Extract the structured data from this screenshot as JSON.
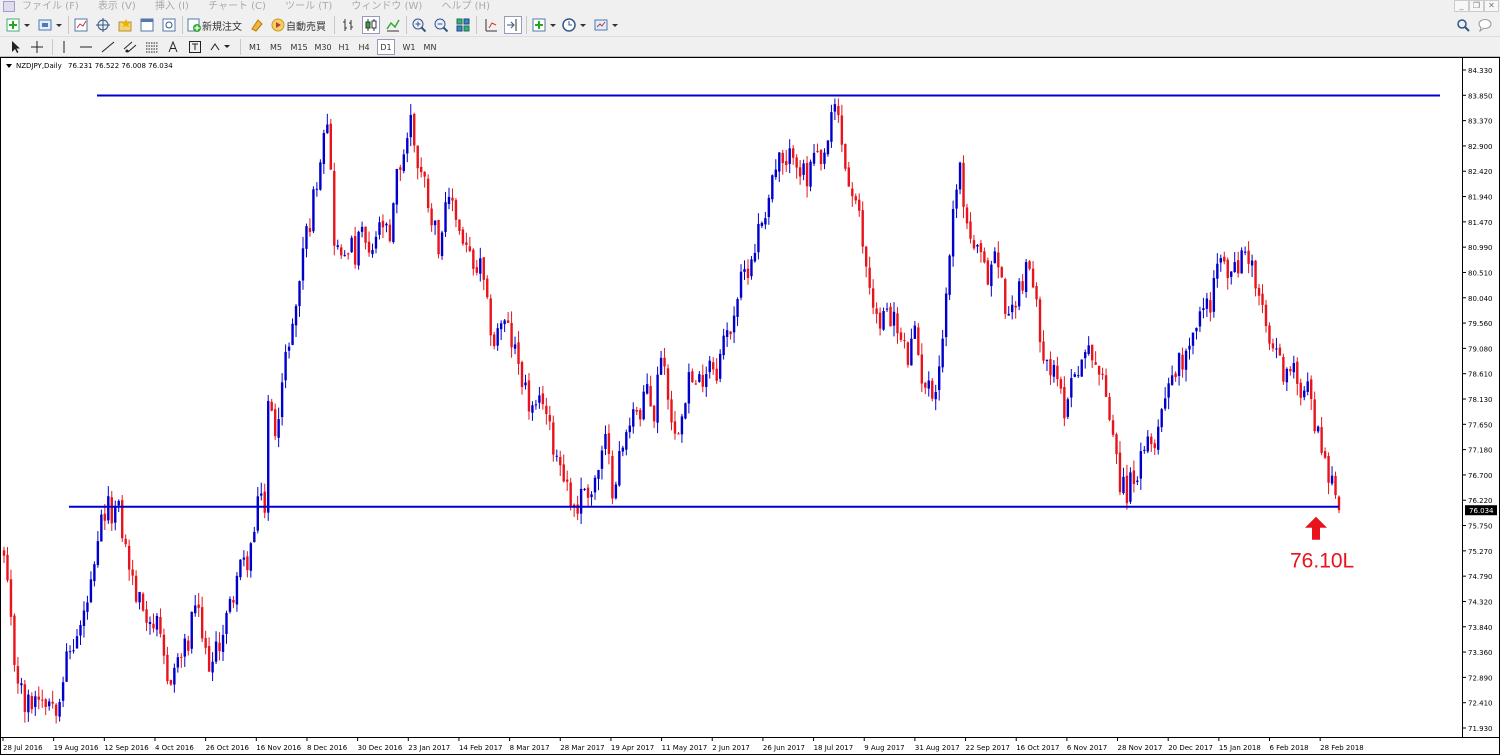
{
  "menu": [
    "ファイル (F)",
    "表示 (V)",
    "挿入 (I)",
    "チャート (C)",
    "ツール (T)",
    "ウィンドウ (W)",
    "ヘルプ (H)"
  ],
  "toolbar": {
    "new_order": "新規注文",
    "auto_trading": "自動売買"
  },
  "timeframes": [
    "M1",
    "M5",
    "M15",
    "M30",
    "H1",
    "H4",
    "D1",
    "W1",
    "MN"
  ],
  "active_timeframe": "D1",
  "chart_header": {
    "symbol": "NZDJPY,Daily",
    "ohlc": "76.231 76.522 76.008 76.034"
  },
  "annotation": {
    "label": "76.10L",
    "color": "#e8131b"
  },
  "colors": {
    "bull": "#0000cc",
    "bear": "#e8131b",
    "line": "#0000cc"
  },
  "chart_data": {
    "type": "candlestick",
    "y_ticks": [
      "84.330",
      "83.850",
      "83.370",
      "82.900",
      "82.420",
      "81.940",
      "81.470",
      "80.990",
      "80.510",
      "80.040",
      "79.560",
      "79.080",
      "78.610",
      "78.130",
      "77.650",
      "77.180",
      "76.700",
      "76.220",
      "75.750",
      "75.270",
      "74.790",
      "74.320",
      "73.840",
      "73.360",
      "72.890",
      "72.410",
      "71.930"
    ],
    "x_ticks": [
      "28 Jul 2016",
      "19 Aug 2016",
      "12 Sep 2016",
      "4 Oct 2016",
      "26 Oct 2016",
      "16 Nov 2016",
      "8 Dec 2016",
      "30 Dec 2016",
      "23 Jan 2017",
      "14 Feb 2017",
      "8 Mar 2017",
      "28 Mar 2017",
      "19 Apr 2017",
      "11 May 2017",
      "2 Jun 2017",
      "26 Jun 2017",
      "18 Jul 2017",
      "9 Aug 2017",
      "31 Aug 2017",
      "22 Sep 2017",
      "16 Oct 2017",
      "6 Nov 2017",
      "28 Nov 2017",
      "20 Dec 2017",
      "15 Jan 2018",
      "6 Feb 2018",
      "28 Feb 2018"
    ],
    "ylim": [
      71.93,
      84.33
    ],
    "current_price": "76.034",
    "resistance_level": 83.85,
    "support_level": 76.1,
    "path": [
      [
        0,
        75.1
      ],
      [
        3,
        73.2
      ],
      [
        6,
        72.3
      ],
      [
        10,
        72.6
      ],
      [
        15,
        72.4
      ],
      [
        18,
        73.2
      ],
      [
        22,
        73.8
      ],
      [
        26,
        74.8
      ],
      [
        28,
        75.8
      ],
      [
        30,
        76.05
      ],
      [
        33,
        76.0
      ],
      [
        35,
        75.3
      ],
      [
        38,
        74.4
      ],
      [
        41,
        74.1
      ],
      [
        44,
        73.8
      ],
      [
        47,
        72.8
      ],
      [
        50,
        73.2
      ],
      [
        53,
        73.5
      ],
      [
        55,
        74.3
      ],
      [
        58,
        73.3
      ],
      [
        60,
        73.1
      ],
      [
        63,
        73.8
      ],
      [
        65,
        74.2
      ],
      [
        67,
        74.8
      ],
      [
        70,
        75.1
      ],
      [
        72,
        75.6
      ],
      [
        74,
        76.5
      ],
      [
        75,
        76.0
      ],
      [
        76,
        78.0
      ],
      [
        78,
        77.6
      ],
      [
        80,
        78.4
      ],
      [
        82,
        79.3
      ],
      [
        84,
        79.8
      ],
      [
        86,
        81.0
      ],
      [
        88,
        81.5
      ],
      [
        90,
        82.3
      ],
      [
        92,
        83.3
      ],
      [
        93,
        83.5
      ],
      [
        95,
        81.2
      ],
      [
        97,
        80.7
      ],
      [
        99,
        81.1
      ],
      [
        101,
        80.8
      ],
      [
        103,
        81.3
      ],
      [
        105,
        80.7
      ],
      [
        107,
        81.2
      ],
      [
        109,
        81.4
      ],
      [
        111,
        81.0
      ],
      [
        113,
        82.3
      ],
      [
        115,
        82.8
      ],
      [
        117,
        83.4
      ],
      [
        119,
        82.6
      ],
      [
        121,
        82.2
      ],
      [
        123,
        81.6
      ],
      [
        125,
        81.1
      ],
      [
        127,
        81.6
      ],
      [
        129,
        81.9
      ],
      [
        131,
        81.3
      ],
      [
        133,
        81.0
      ],
      [
        135,
        80.5
      ],
      [
        137,
        80.6
      ],
      [
        139,
        79.8
      ],
      [
        141,
        79.2
      ],
      [
        143,
        79.6
      ],
      [
        145,
        79.4
      ],
      [
        147,
        79.0
      ],
      [
        149,
        78.6
      ],
      [
        151,
        78.0
      ],
      [
        153,
        77.8
      ],
      [
        155,
        78.2
      ],
      [
        157,
        77.5
      ],
      [
        159,
        77.1
      ],
      [
        161,
        76.8
      ],
      [
        163,
        76.2
      ],
      [
        165,
        76.1
      ],
      [
        167,
        76.5
      ],
      [
        169,
        76.4
      ],
      [
        171,
        76.8
      ],
      [
        173,
        77.3
      ],
      [
        175,
        76.5
      ],
      [
        177,
        77.0
      ],
      [
        179,
        77.4
      ],
      [
        181,
        78.1
      ],
      [
        183,
        77.7
      ],
      [
        185,
        78.4
      ],
      [
        187,
        77.8
      ],
      [
        189,
        79.1
      ],
      [
        191,
        78.3
      ],
      [
        193,
        77.4
      ],
      [
        195,
        78.0
      ],
      [
        197,
        78.6
      ],
      [
        199,
        78.3
      ],
      [
        201,
        78.6
      ],
      [
        203,
        78.9
      ],
      [
        205,
        78.7
      ],
      [
        207,
        79.2
      ],
      [
        209,
        79.5
      ],
      [
        211,
        80.1
      ],
      [
        213,
        80.5
      ],
      [
        215,
        80.8
      ],
      [
        217,
        81.3
      ],
      [
        219,
        81.7
      ],
      [
        221,
        82.3
      ],
      [
        223,
        82.6
      ],
      [
        225,
        82.4
      ],
      [
        227,
        82.9
      ],
      [
        229,
        82.5
      ],
      [
        231,
        82.2
      ],
      [
        233,
        82.7
      ],
      [
        235,
        82.4
      ],
      [
        237,
        83.0
      ],
      [
        239,
        83.6
      ],
      [
        240,
        83.4
      ],
      [
        242,
        82.5
      ],
      [
        244,
        81.9
      ],
      [
        246,
        81.5
      ],
      [
        248,
        80.6
      ],
      [
        250,
        80.0
      ],
      [
        252,
        79.4
      ],
      [
        254,
        79.9
      ],
      [
        256,
        79.6
      ],
      [
        258,
        79.2
      ],
      [
        260,
        78.9
      ],
      [
        262,
        79.3
      ],
      [
        264,
        78.6
      ],
      [
        266,
        78.3
      ],
      [
        268,
        78.4
      ],
      [
        270,
        79.3
      ],
      [
        272,
        80.9
      ],
      [
        274,
        82.3
      ],
      [
        275,
        82.4
      ],
      [
        277,
        81.4
      ],
      [
        279,
        81.0
      ],
      [
        281,
        80.7
      ],
      [
        283,
        80.4
      ],
      [
        285,
        80.9
      ],
      [
        287,
        80.3
      ],
      [
        289,
        79.6
      ],
      [
        291,
        80.1
      ],
      [
        293,
        80.4
      ],
      [
        295,
        80.6
      ],
      [
        297,
        79.8
      ],
      [
        299,
        79.1
      ],
      [
        301,
        78.7
      ],
      [
        303,
        78.4
      ],
      [
        305,
        78.0
      ],
      [
        307,
        78.5
      ],
      [
        309,
        78.8
      ],
      [
        311,
        78.9
      ],
      [
        313,
        79.1
      ],
      [
        315,
        78.6
      ],
      [
        317,
        78.2
      ],
      [
        319,
        77.6
      ],
      [
        321,
        76.6
      ],
      [
        323,
        76.4
      ],
      [
        325,
        76.7
      ],
      [
        327,
        76.9
      ],
      [
        329,
        77.2
      ],
      [
        331,
        77.4
      ],
      [
        333,
        77.9
      ],
      [
        335,
        78.6
      ],
      [
        337,
        78.7
      ],
      [
        339,
        78.9
      ],
      [
        341,
        79.3
      ],
      [
        343,
        79.6
      ],
      [
        345,
        79.8
      ],
      [
        347,
        80.0
      ],
      [
        349,
        80.7
      ],
      [
        351,
        80.6
      ],
      [
        353,
        80.5
      ],
      [
        355,
        80.6
      ],
      [
        357,
        81.0
      ],
      [
        359,
        80.6
      ],
      [
        361,
        80.0
      ],
      [
        363,
        79.4
      ],
      [
        365,
        79.0
      ],
      [
        367,
        78.8
      ],
      [
        369,
        78.6
      ],
      [
        371,
        78.6
      ],
      [
        373,
        78.4
      ],
      [
        375,
        78.6
      ],
      [
        377,
        77.6
      ],
      [
        379,
        77.3
      ],
      [
        381,
        76.8
      ],
      [
        383,
        76.2
      ],
      [
        384,
        76.034
      ]
    ]
  }
}
